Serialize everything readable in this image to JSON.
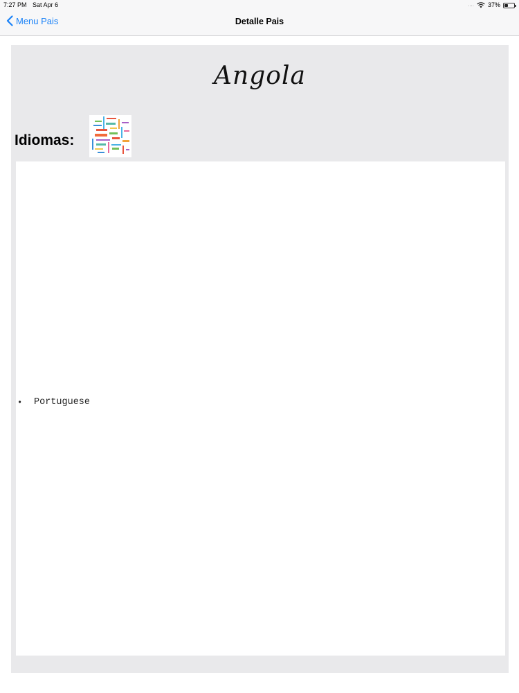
{
  "status_bar": {
    "time": "7:27 PM",
    "date": "Sat Apr 6",
    "signal": "....",
    "battery_label": "37%",
    "battery_level": 0.37,
    "icons": [
      "wifi-icon",
      "battery-icon"
    ]
  },
  "nav": {
    "back_label": "Menu Pais",
    "title": "Detalle Pais",
    "back_icon": "chevron-left-icon",
    "accent_color": "#1a82f7"
  },
  "country": {
    "name": "Angola"
  },
  "languages": {
    "label": "Idiomas:",
    "image_icon": "word-cloud-image",
    "items": [
      "Portuguese"
    ]
  },
  "colors": {
    "panel_background": "#e9e9eb",
    "bar_background": "#f7f7f8"
  }
}
